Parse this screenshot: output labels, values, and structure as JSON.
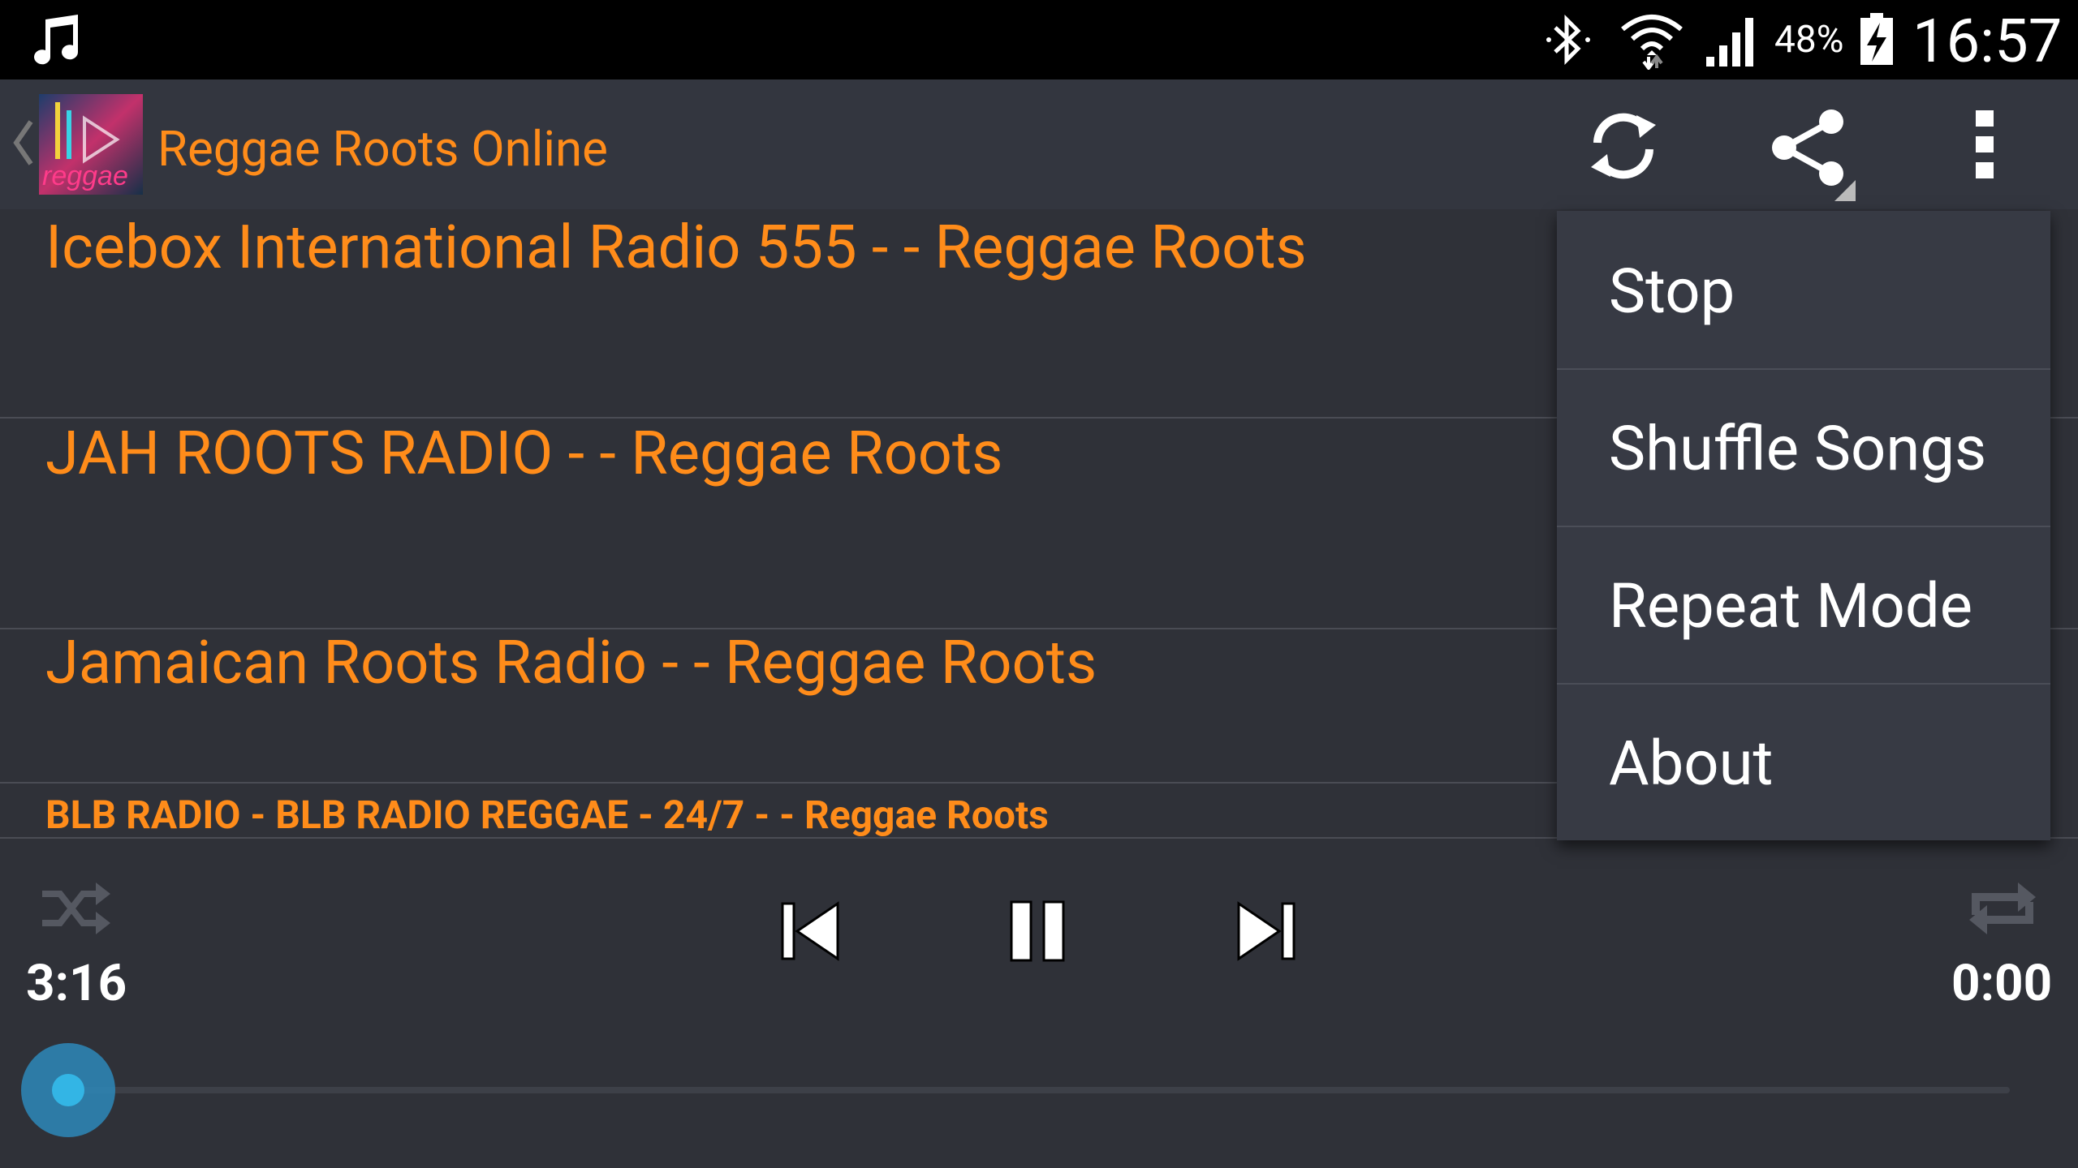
{
  "status_bar": {
    "battery_percent": "48%",
    "time": "16:57",
    "icons": [
      "music-note-icon",
      "bluetooth-icon",
      "wifi-icon",
      "signal-icon",
      "battery-charging-icon"
    ]
  },
  "action_bar": {
    "title": "Reggae Roots Online",
    "logo_text": "reggae"
  },
  "stations": [
    {
      "label": "Icebox International Radio 555 - - Reggae Roots"
    },
    {
      "label": "JAH ROOTS RADIO - - Reggae Roots"
    },
    {
      "label": "Jamaican Roots Radio - - Reggae Roots"
    }
  ],
  "player": {
    "now_playing": "BLB RADIO - BLB RADIO REGGAE - 24/7 - - Reggae Roots",
    "elapsed": "3:16",
    "total": "0:00",
    "progress_fraction": 0.0
  },
  "menu": {
    "items": [
      {
        "label": "Stop"
      },
      {
        "label": "Shuffle Songs"
      },
      {
        "label": "Repeat Mode"
      },
      {
        "label": "About"
      }
    ]
  },
  "colors": {
    "accent": "#ff8c1a",
    "background": "#2f3138",
    "seek_thumb": "#33b5e5"
  }
}
